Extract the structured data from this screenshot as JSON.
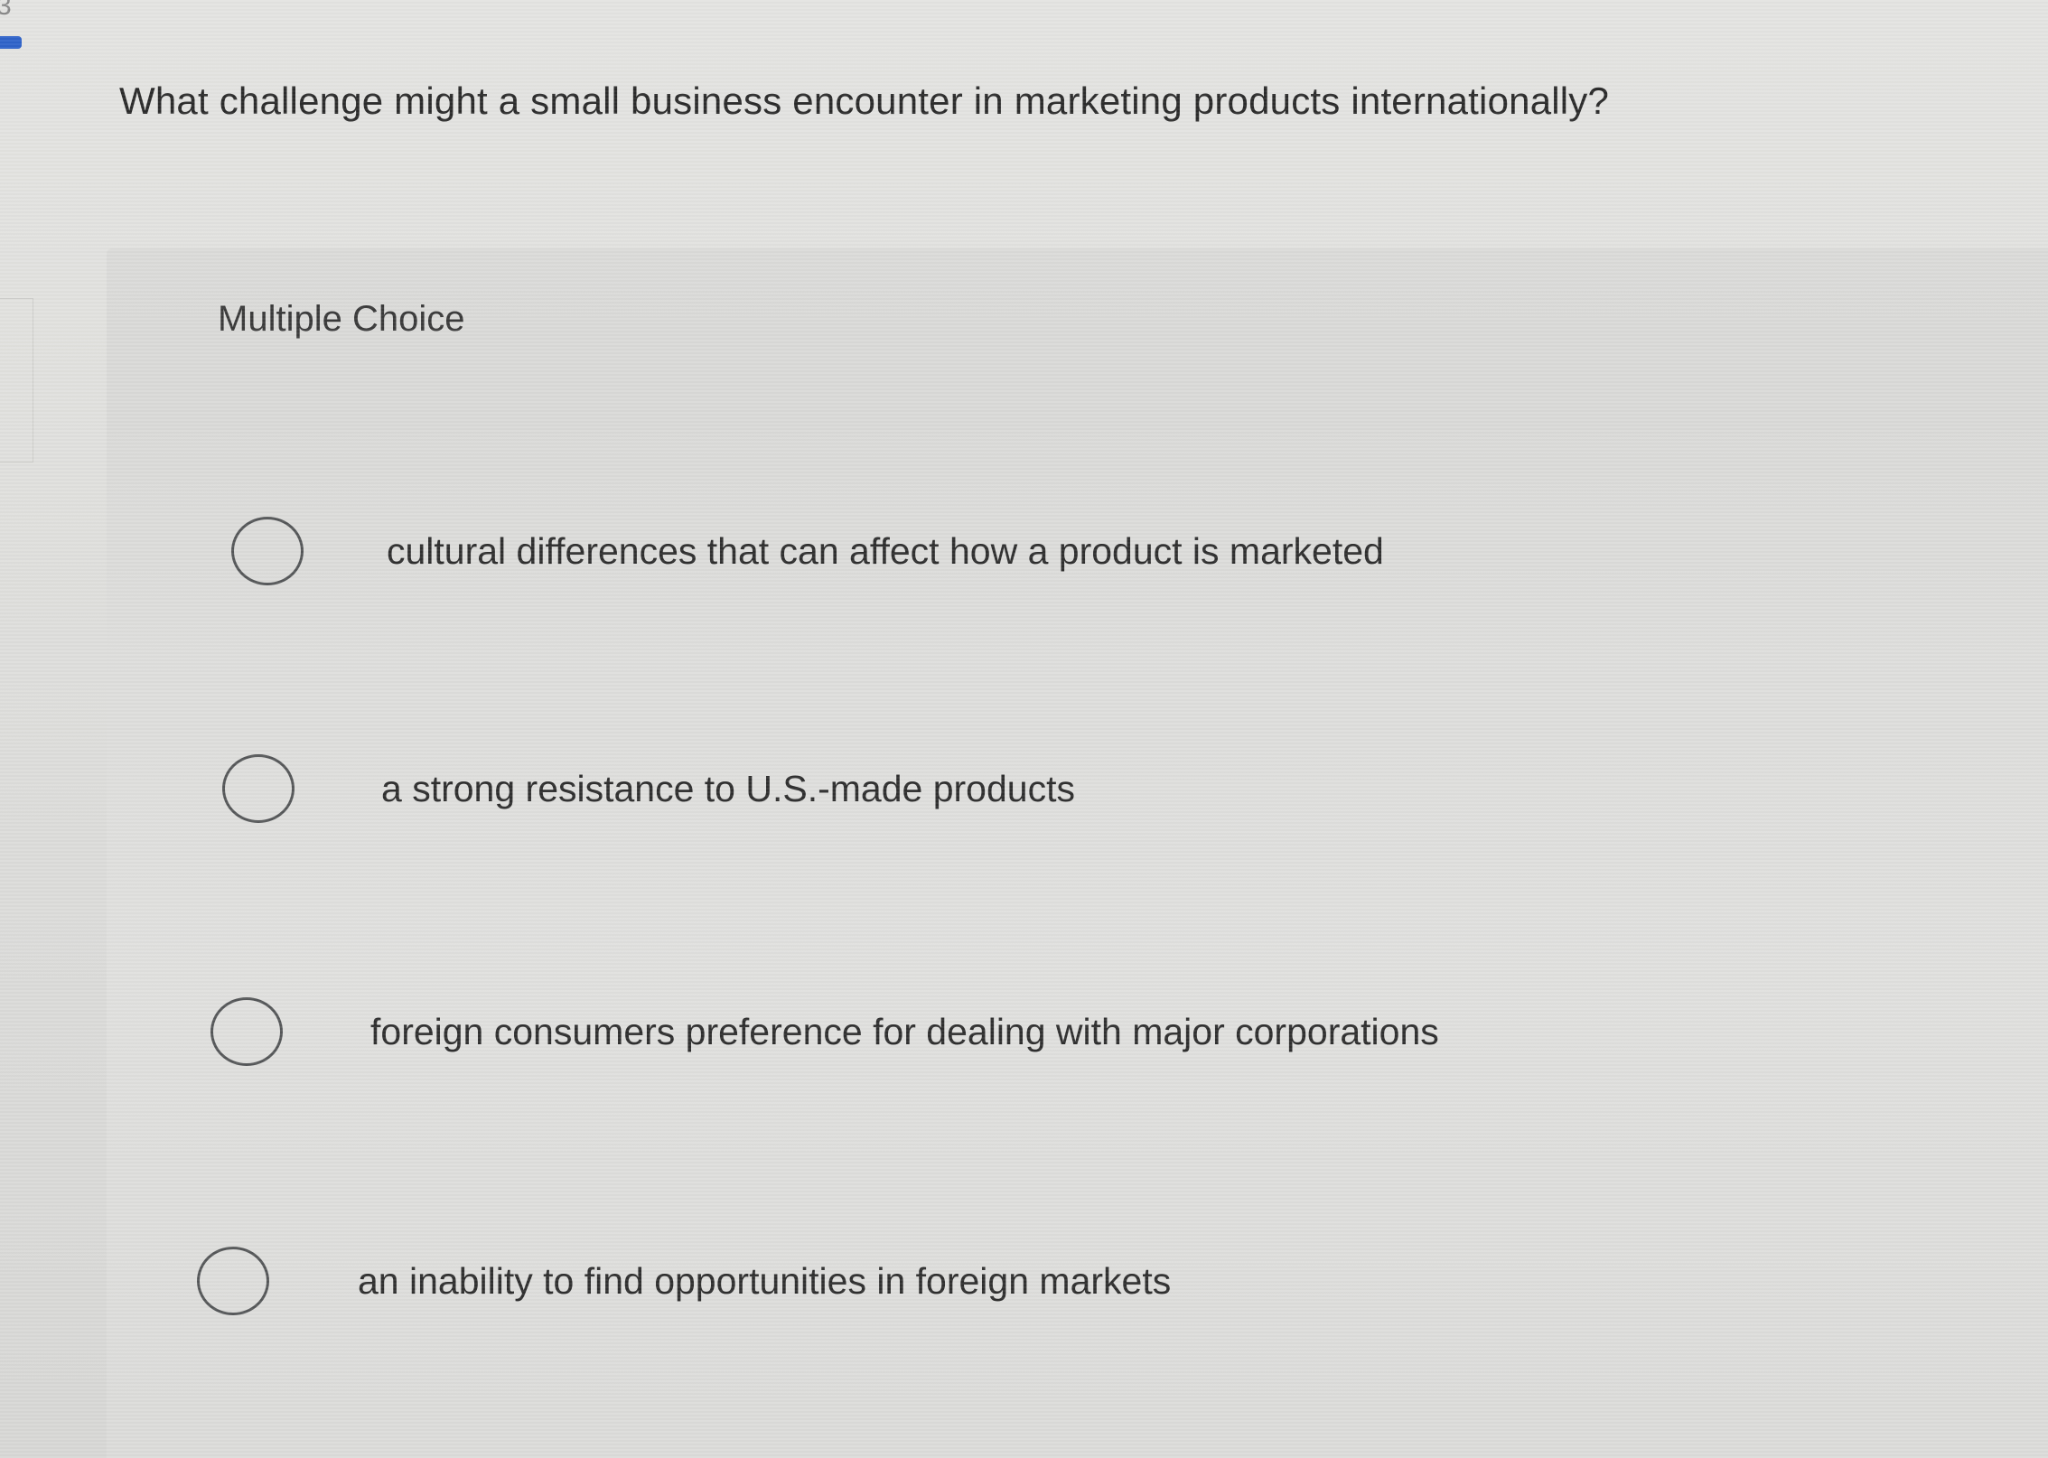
{
  "question": {
    "text": "What challenge might a small business encounter in marketing products internationally?"
  },
  "panel": {
    "label": "Multiple Choice"
  },
  "options": [
    {
      "label": "cultural differences that can affect how a product is marketed",
      "selected": false
    },
    {
      "label": "a strong resistance to U.S.-made products",
      "selected": false
    },
    {
      "label": "foreign consumers preference for dealing with major corporations",
      "selected": false
    },
    {
      "label": "an inability to find opportunities in foreign markets",
      "selected": false
    }
  ],
  "colors": {
    "accent": "#2f63c9",
    "text": "#2d2d2d",
    "radio_border": "#555759",
    "background": "#e2e2df"
  }
}
